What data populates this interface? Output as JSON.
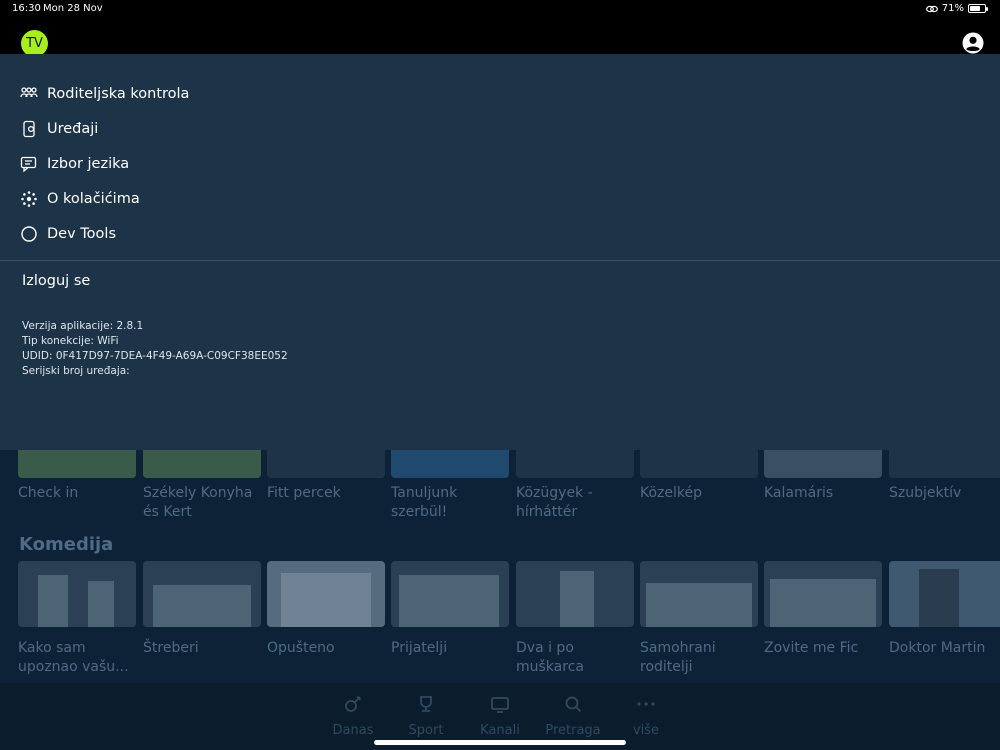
{
  "status_bar": {
    "time": "16:30",
    "date": "Mon 28 Nov",
    "battery": "71%",
    "battery_level": 0.71
  },
  "header": {
    "logo_text": "TV",
    "logo_color": "#a6ef1c"
  },
  "menu": {
    "items": [
      {
        "label": "Roditeljska kontrola",
        "icon": "parental-icon"
      },
      {
        "label": "Uređaji",
        "icon": "device-icon"
      },
      {
        "label": "Izbor jezika",
        "icon": "language-icon"
      },
      {
        "label": "O kolačićima",
        "icon": "cookie-icon"
      },
      {
        "label": "Dev Tools",
        "icon": "circle-icon"
      }
    ],
    "logout_label": "Izloguj se",
    "info": {
      "version": "Verzija aplikacije: 2.8.1",
      "connection": "Tip konekcije: WiFi",
      "udid": "UDID: 0F417D97-7DEA-4F49-A69A-C09CF38EE052",
      "serial": "Serijski broj uređaja:"
    }
  },
  "background": {
    "row1": [
      {
        "title": "Check in"
      },
      {
        "title": "Székely Konyha és Kert"
      },
      {
        "title": "Fitt percek"
      },
      {
        "title": "Tanuljunk szerbül!"
      },
      {
        "title": "Közügyek - hírháttér"
      },
      {
        "title": "Közelkép"
      },
      {
        "title": "Kalamáris"
      },
      {
        "title": "Szubjektív"
      }
    ],
    "section_title": "Komedija",
    "row2": [
      {
        "title": "Kako sam upoznao vašu..."
      },
      {
        "title": "Štreberi"
      },
      {
        "title": "Opušteno"
      },
      {
        "title": "Prijatelji"
      },
      {
        "title": "Dva i po muškarca"
      },
      {
        "title": "Samohrani roditelji"
      },
      {
        "title": "Zovite me Fic"
      },
      {
        "title": "Doktor Martin"
      }
    ]
  },
  "bottom_nav": [
    {
      "label": "Danas",
      "icon": "satellite-icon"
    },
    {
      "label": "Sport",
      "icon": "trophy-icon"
    },
    {
      "label": "Kanali",
      "icon": "tv-icon"
    },
    {
      "label": "Pretraga",
      "icon": "search-icon"
    },
    {
      "label": "više",
      "icon": "more-icon"
    }
  ]
}
